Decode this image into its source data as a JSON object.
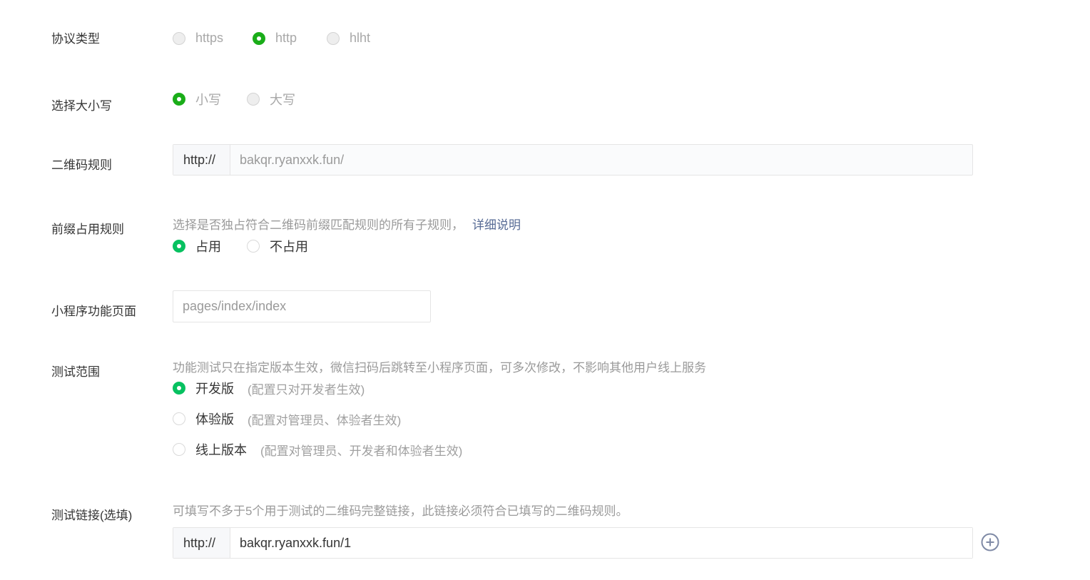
{
  "protocol": {
    "label": "协议类型",
    "options": [
      "https",
      "http",
      "hlht"
    ],
    "selected": "http"
  },
  "case": {
    "label": "选择大小写",
    "options": [
      "小写",
      "大写"
    ],
    "selected": "小写"
  },
  "qr_rule": {
    "label": "二维码规则",
    "prefix": "http://",
    "value": "bakqr.ryanxxk.fun/"
  },
  "prefix_rule": {
    "label": "前缀占用规则",
    "description": "选择是否独占符合二维码前缀匹配规则的所有子规则，",
    "link": "详细说明",
    "options": [
      "占用",
      "不占用"
    ],
    "selected": "占用"
  },
  "page": {
    "label": "小程序功能页面",
    "placeholder": "pages/index/index"
  },
  "test_scope": {
    "label": "测试范围",
    "description": "功能测试只在指定版本生效，微信扫码后跳转至小程序页面，可多次修改，不影响其他用户线上服务",
    "options": [
      {
        "label": "开发版",
        "note": "(配置只对开发者生效)"
      },
      {
        "label": "体验版",
        "note": "(配置对管理员、体验者生效)"
      },
      {
        "label": "线上版本",
        "note": "(配置对管理员、开发者和体验者生效)"
      }
    ],
    "selected": "开发版"
  },
  "test_link": {
    "label": "测试链接(选填)",
    "description": "可填写不多于5个用于测试的二维码完整链接，此链接必须符合已填写的二维码规则。",
    "prefix": "http://",
    "value": "bakqr.ryanxxk.fun/1",
    "add_icon": "plus-circle-icon"
  },
  "colors": {
    "primary_green": "#07c160",
    "dark_green": "#1aad19",
    "link": "#576b95"
  }
}
